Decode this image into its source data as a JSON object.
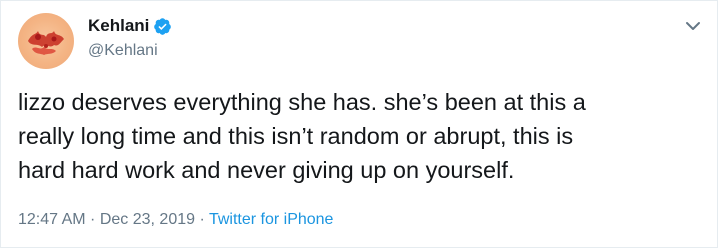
{
  "tweet": {
    "author": {
      "display_name": "Kehlani",
      "handle": "@Kehlani",
      "verified": true,
      "avatar_icon": "profile-avatar-icon"
    },
    "text_lines": [
      "lizzo deserves everything she has. she’s been at this a",
      "really long time and this isn’t random or abrupt, this is",
      "hard hard work and never giving up on yourself."
    ],
    "meta": {
      "time": "12:47 AM",
      "separator": " · ",
      "date": "Dec 23, 2019",
      "source": "Twitter for iPhone"
    },
    "icons": {
      "verified": "verified-badge-icon",
      "menu": "chevron-down-icon"
    },
    "colors": {
      "text": "#14171a",
      "secondary": "#657786",
      "link": "#1b95e0",
      "verified": "#1da1f2"
    }
  }
}
